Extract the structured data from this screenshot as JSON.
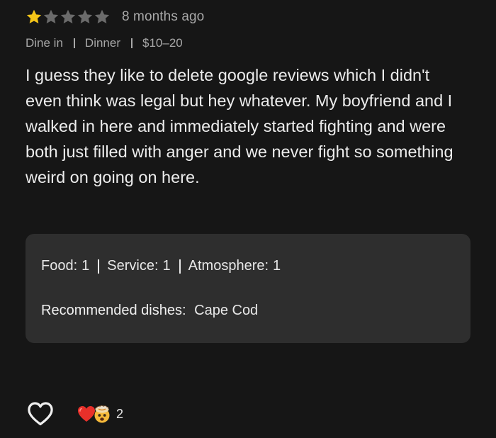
{
  "review": {
    "rating": 1,
    "max_rating": 5,
    "time_ago": "8 months ago",
    "meta": {
      "service_type": "Dine in",
      "meal_type": "Dinner",
      "price_range": "$10–20"
    },
    "text": "I guess they like to delete google reviews which I didn't even think was legal but hey whatever. My boyfriend and I walked in here and immediately started fighting and were both just filled with anger and we never fight so something weird on going on here.",
    "ratings": {
      "food_label": "Food:",
      "food_value": "1",
      "service_label": "Service:",
      "service_value": "1",
      "atmosphere_label": "Atmosphere:",
      "atmosphere_value": "1"
    },
    "recommended_dishes_label": "Recommended dishes:",
    "recommended_dishes": "Cape Cod",
    "reactions": {
      "emojis": [
        "red-heart-icon",
        "exploding-head-icon"
      ],
      "count": "2"
    }
  },
  "colors": {
    "background": "#161616",
    "star_filled": "#f5c518",
    "star_empty": "#6b6b6b",
    "card_background": "#2e2e2e",
    "secondary_text": "#a8a8a8",
    "primary_text": "#ececec"
  }
}
